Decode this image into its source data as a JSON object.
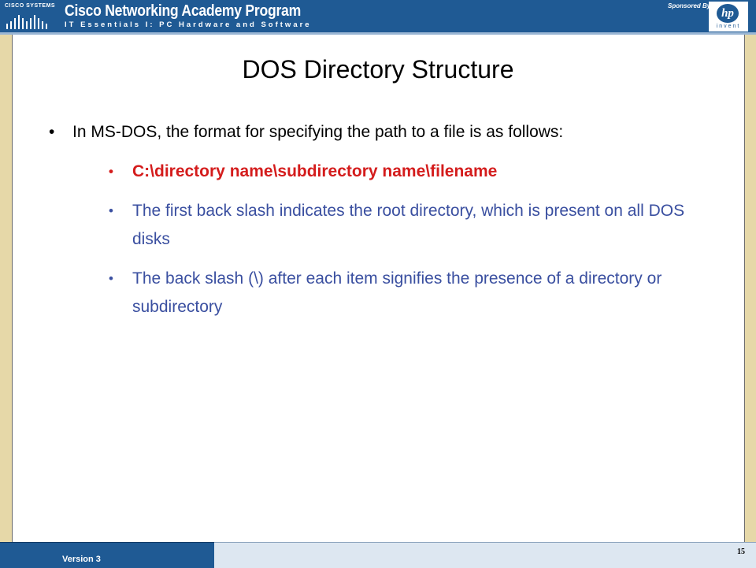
{
  "header": {
    "company_logo": "CISCO SYSTEMS",
    "program_title": "Cisco Networking Academy Program",
    "program_subtitle": "IT Essentials I: PC Hardware and Software",
    "sponsor_label": "Sponsored By:",
    "sponsor_logo": "hp",
    "sponsor_tagline": "invent"
  },
  "slide": {
    "title": "DOS Directory Structure",
    "bullet": "In MS-DOS, the format for specifying the path to a file is as follows:",
    "sub_bullets": [
      "C:\\directory name\\subdirectory name\\filename",
      "The first back slash indicates the root directory, which is present on all DOS disks",
      "The back slash (\\) after each item signifies the presence of a directory or subdirectory"
    ]
  },
  "footer": {
    "version": "Version 3",
    "page_number": "15"
  },
  "colors": {
    "header_blue": "#1f5a94",
    "frame_tan": "#e6d8a8",
    "sub_bullet_blue": "#3a4fa0",
    "path_red": "#d41c1c"
  },
  "icons": [
    "cisco-bridge-icon",
    "hp-logo-icon"
  ]
}
